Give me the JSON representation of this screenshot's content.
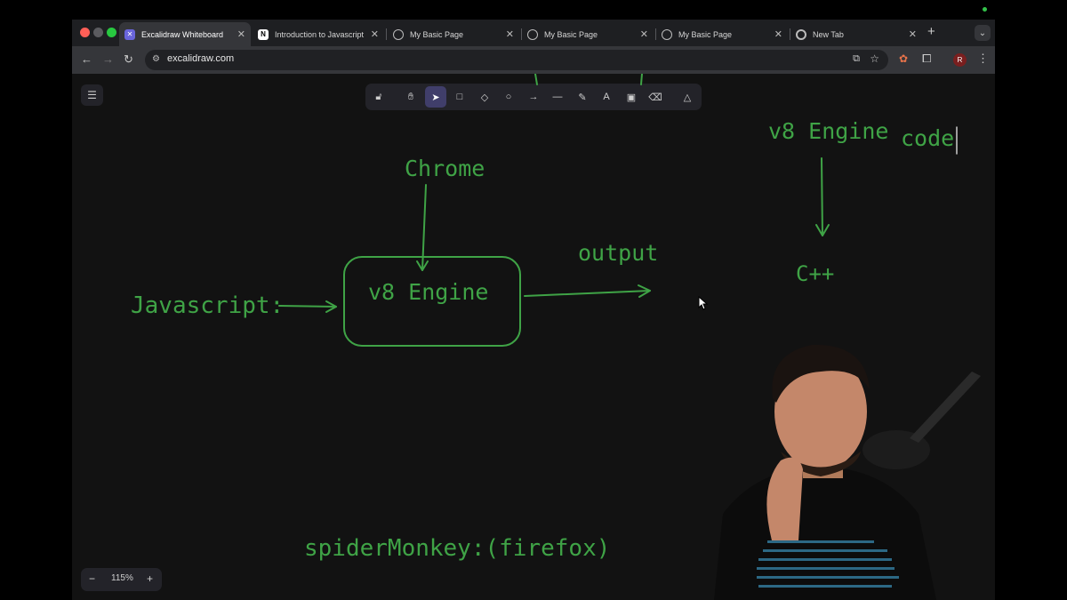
{
  "browser": {
    "tabs": [
      {
        "title": "Excalidraw Whiteboard",
        "icon": "excalidraw-icon",
        "active": true
      },
      {
        "title": "Introduction to Javascript",
        "icon": "notion-icon",
        "active": false
      },
      {
        "title": "My Basic Page",
        "icon": "globe-icon",
        "active": false
      },
      {
        "title": "My Basic Page",
        "icon": "globe-icon",
        "active": false
      },
      {
        "title": "My Basic Page",
        "icon": "globe-icon",
        "active": false
      },
      {
        "title": "New Tab",
        "icon": "chrome-icon",
        "active": false
      }
    ],
    "url": "excalidraw.com",
    "profile_initial": "R"
  },
  "whiteboard": {
    "labels": {
      "chrome": "Chrome",
      "v8_box": "v8 Engine",
      "javascript": "Javascript:",
      "output": "output",
      "v8_right": "v8 Engine",
      "code": "code",
      "cpp": "C++",
      "spidermonkey": "spiderMonkey:(firefox)"
    },
    "stroke_color": "#3fa346"
  },
  "zoom": {
    "minus": "−",
    "level": "115%",
    "plus": "+"
  },
  "colors": {
    "canvas": "#121212",
    "toolbar": "#232329",
    "selected_tool": "#403e6a",
    "accent": "#3fa346"
  }
}
